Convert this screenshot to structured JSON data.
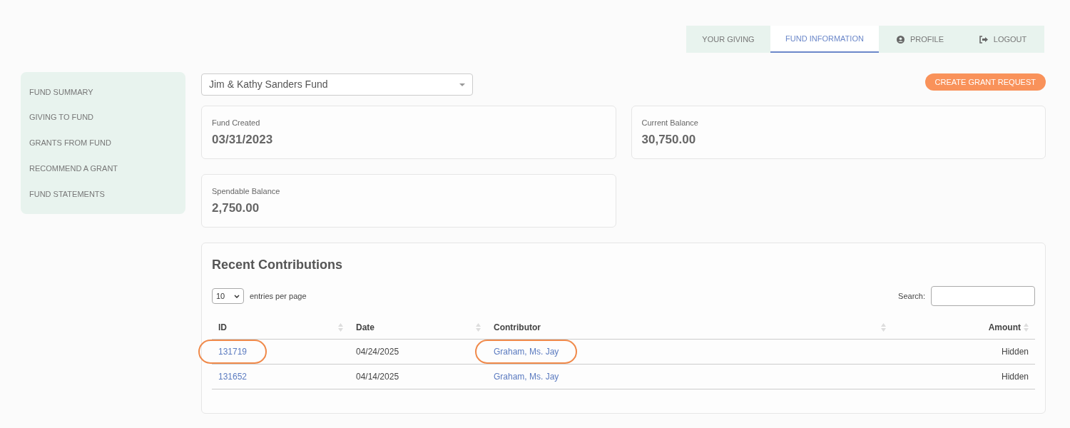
{
  "nav_tabs": [
    {
      "label": "YOUR GIVING",
      "kind": "plain",
      "selected": false
    },
    {
      "label": "FUND INFORMATION",
      "kind": "plain",
      "selected": true
    },
    {
      "label": "PROFILE",
      "kind": "profile",
      "selected": false
    },
    {
      "label": "LOGOUT",
      "kind": "logout",
      "selected": false
    }
  ],
  "sidebar": {
    "items": [
      "FUND SUMMARY",
      "GIVING TO FUND",
      "GRANTS FROM FUND",
      "RECOMMEND A GRANT",
      "FUND STATEMENTS"
    ]
  },
  "fund_select": {
    "value": "Jim & Kathy Sanders Fund"
  },
  "create_button": "CREATE GRANT REQUEST",
  "stats": [
    {
      "label": "Fund Created",
      "value": "03/31/2023"
    },
    {
      "label": "Current Balance",
      "value": "30,750.00"
    },
    {
      "label": "Spendable Balance",
      "value": "2,750.00"
    }
  ],
  "contributions": {
    "title": "Recent Contributions",
    "page_size": "10",
    "page_size_label": "entries per page",
    "search_label": "Search:",
    "columns": [
      "ID",
      "Date",
      "Contributor",
      "Amount"
    ],
    "rows": [
      {
        "id": "131719",
        "date": "04/24/2025",
        "contributor": "Graham, Ms. Jay",
        "amount": "Hidden",
        "highlighted": true
      },
      {
        "id": "131652",
        "date": "04/14/2025",
        "contributor": "Graham, Ms. Jay",
        "amount": "Hidden",
        "highlighted": false
      }
    ]
  }
}
